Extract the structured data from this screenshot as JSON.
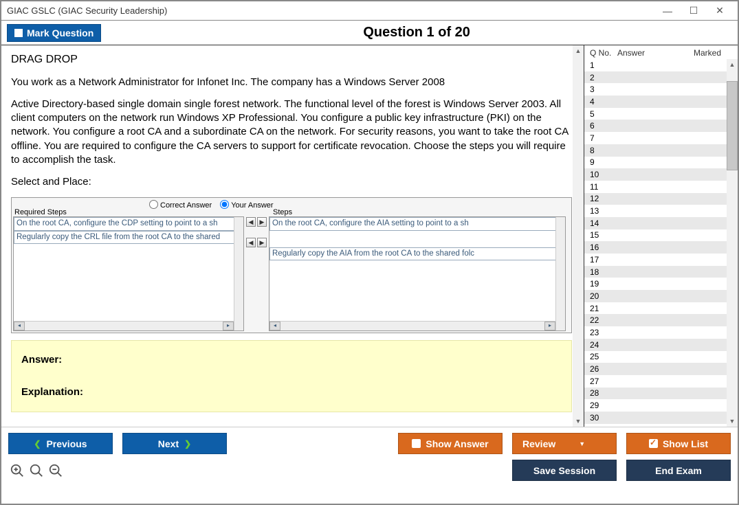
{
  "titlebar": {
    "text": "GIAC GSLC (GIAC Security Leadership)"
  },
  "header": {
    "mark_label": "Mark Question",
    "question_title": "Question 1 of 20"
  },
  "content": {
    "heading": "DRAG DROP",
    "para1": "You work as a Network Administrator for Infonet Inc. The company has a Windows Server 2008",
    "para2": "Active Directory-based single domain single forest network. The functional level of the forest is Windows Server 2003. All client computers on the network run Windows XP Professional. You configure a public key infrastructure (PKI) on the network. You configure a root CA and a subordinate CA on the network. For security reasons, you want to take the root CA offline. You are required to configure the CA servers to support for certificate revocation. Choose the steps you will require to accomplish the task.",
    "select_label": "Select and Place:",
    "radio_correct": "Correct Answer",
    "radio_your": "Your Answer",
    "left_label": "Required Steps",
    "right_label": "Steps",
    "left_items": [
      "On the root CA, configure the CDP setting to point to a sh",
      "Regularly copy the CRL file from the root CA to the shared"
    ],
    "right_items": [
      "On the root CA, configure the AIA setting to point to a sh",
      "Regularly copy the AIA from the root CA to the shared folc"
    ],
    "answer_label": "Answer:",
    "explanation_label": "Explanation:"
  },
  "sidebar": {
    "col_qno": "Q No.",
    "col_answer": "Answer",
    "col_marked": "Marked",
    "rows": [
      1,
      2,
      3,
      4,
      5,
      6,
      7,
      8,
      9,
      10,
      11,
      12,
      13,
      14,
      15,
      16,
      17,
      18,
      19,
      20,
      21,
      22,
      23,
      24,
      25,
      26,
      27,
      28,
      29,
      30
    ]
  },
  "footer": {
    "previous": "Previous",
    "next": "Next",
    "show_answer": "Show Answer",
    "review": "Review",
    "show_list": "Show List",
    "save_session": "Save Session",
    "end_exam": "End Exam"
  }
}
